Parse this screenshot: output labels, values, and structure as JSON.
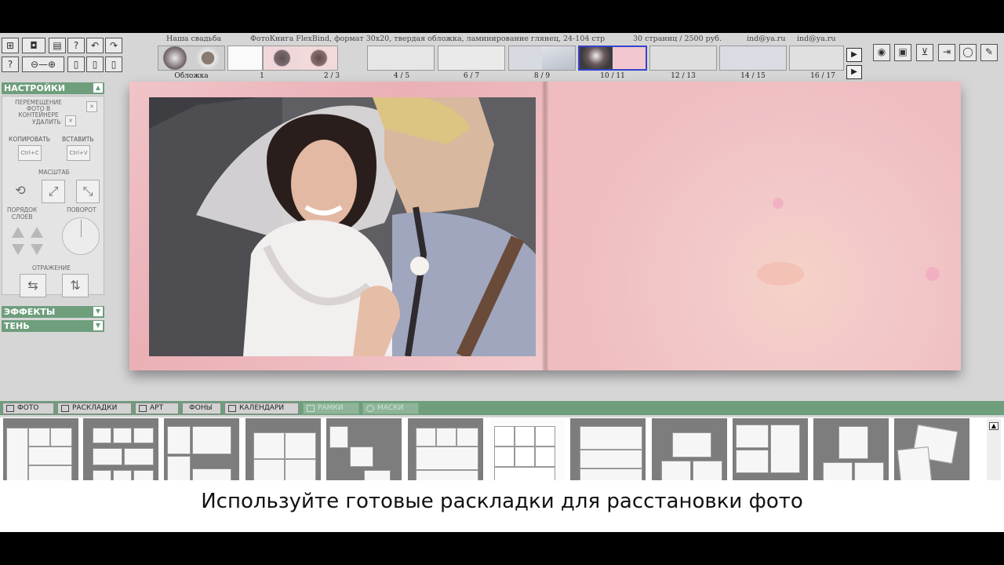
{
  "project_bar": {
    "title": "Наша свадьба",
    "book_type": "ФотоКнига  FlexBind, формат  30x20,  твердая обложка, ламинирование глянец,  24-104 стр",
    "pages_price": "30 страниц  / 2500 руб.",
    "email1": "ind@ya.ru",
    "email2": "ind@ya.ru"
  },
  "thumbnail_labels": [
    "Обложка",
    "1",
    "2 / 3",
    "4 / 5",
    "6 / 7",
    "8 / 9",
    "10 / 11",
    "12 / 13",
    "14 / 15",
    "16 / 17"
  ],
  "selected_thumbnail": "10 / 11",
  "left_panel": {
    "settings_header": "НАСТРОЙКИ",
    "move_photo_label": "ПЕРЕМЕЩЕНИЕ ФОТО В КОНТЕЙНЕРЕ",
    "delete_label": "УДАЛИТЬ",
    "copy_label": "КОПИРОВАТЬ",
    "paste_label": "ВСТАВИТЬ",
    "copy_shortcut": "Ctrl+C",
    "paste_shortcut": "Ctrl+V",
    "scale_label": "МАСШТАБ",
    "layer_order_label": "ПОРЯДОК\nСЛОЕВ",
    "rotate_label": "ПОВОРОТ",
    "mirror_label": "ОТРАЖЕНИЕ",
    "effects_header": "ЭФФЕКТЫ",
    "shadow_header": "ТЕНЬ"
  },
  "bottom_tabs": [
    {
      "label": "ФОТО",
      "enabled": true
    },
    {
      "label": "РАСКЛАДКИ",
      "enabled": true
    },
    {
      "label": "АРТ",
      "enabled": true
    },
    {
      "label": "ФОНЫ",
      "enabled": true
    },
    {
      "label": "КАЛЕНДАРИ",
      "enabled": true
    },
    {
      "label": "РАМКИ",
      "enabled": false
    },
    {
      "label": "МАСКИ",
      "enabled": false
    }
  ],
  "nav": {
    "next_icon": "play-right-icon",
    "last_icon": "play-right-icon"
  },
  "colors": {
    "panel_green": "#6e9e7c",
    "page_pink": "#efbcc0",
    "selected_border": "#3344cc"
  },
  "caption": "Используйте готовые раскладки для расстановки фото"
}
